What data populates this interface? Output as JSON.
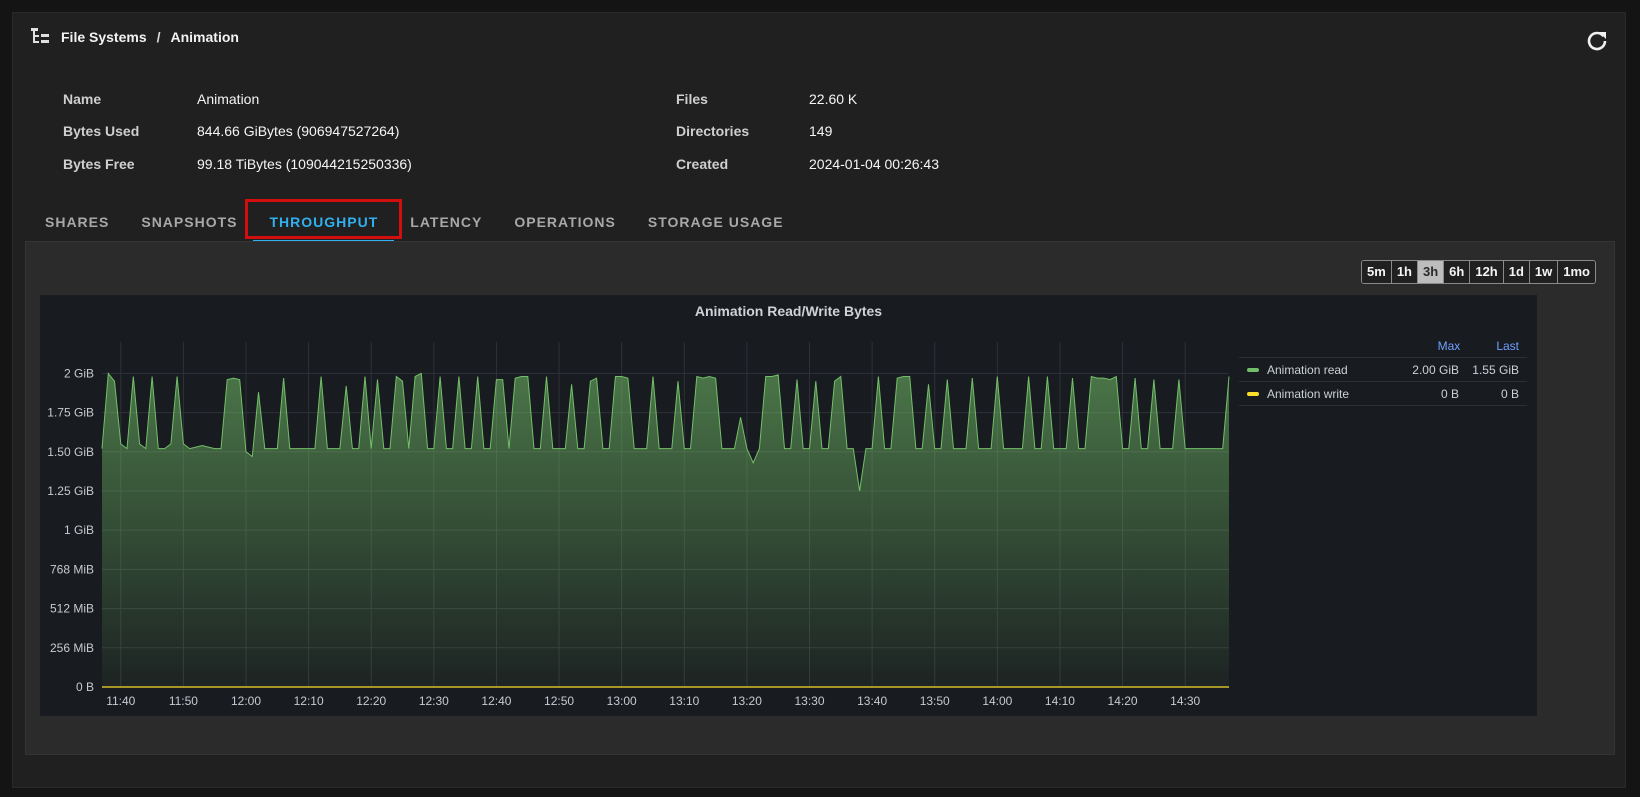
{
  "breadcrumb": {
    "root": "File Systems",
    "separator": "/",
    "current": "Animation"
  },
  "icons": {
    "tree": "tree-structure-icon",
    "refresh": "refresh-icon"
  },
  "details": {
    "name_label": "Name",
    "name_value": "Animation",
    "bytes_used_label": "Bytes Used",
    "bytes_used_value": "844.66 GiBytes (906947527264)",
    "bytes_free_label": "Bytes Free",
    "bytes_free_value": "99.18 TiBytes (109044215250336)",
    "files_label": "Files",
    "files_value": "22.60 K",
    "directories_label": "Directories",
    "directories_value": "149",
    "created_label": "Created",
    "created_value": "2024-01-04 00:26:43"
  },
  "tabs": [
    {
      "label": "SHARES"
    },
    {
      "label": "SNAPSHOTS"
    },
    {
      "label": "THROUGHPUT",
      "active": true
    },
    {
      "label": "LATENCY"
    },
    {
      "label": "OPERATIONS"
    },
    {
      "label": "STORAGE USAGE"
    }
  ],
  "time_ranges": [
    "5m",
    "1h",
    "3h",
    "6h",
    "12h",
    "1d",
    "1w",
    "1mo"
  ],
  "selected_range": "3h",
  "colors": {
    "accent": "#31b0ef",
    "read": "#73bf69",
    "write": "#fade2a",
    "highlight": "#d10f0f"
  },
  "legend": {
    "max_header": "Max",
    "last_header": "Last",
    "rows": [
      {
        "name": "Animation read",
        "max": "2.00 GiB",
        "last": "1.55 GiB"
      },
      {
        "name": "Animation write",
        "max": "0 B",
        "last": "0 B"
      }
    ]
  },
  "chart_data": {
    "type": "area",
    "title": "Animation Read/Write Bytes",
    "y_unit": "GiB",
    "ylim": [
      0,
      2.2
    ],
    "y_ticks": [
      {
        "value": 0,
        "label": "0 B"
      },
      {
        "value": 0.25,
        "label": "256 MiB"
      },
      {
        "value": 0.5,
        "label": "512 MiB"
      },
      {
        "value": 0.75,
        "label": "768 MiB"
      },
      {
        "value": 1,
        "label": "1 GiB"
      },
      {
        "value": 1.25,
        "label": "1.25 GiB"
      },
      {
        "value": 1.5,
        "label": "1.50 GiB"
      },
      {
        "value": 1.75,
        "label": "1.75 GiB"
      },
      {
        "value": 2,
        "label": "2 GiB"
      }
    ],
    "x_ticks": [
      "11:40",
      "11:50",
      "12:00",
      "12:10",
      "12:20",
      "12:30",
      "12:40",
      "12:50",
      "13:00",
      "13:10",
      "13:20",
      "13:30",
      "13:40",
      "13:50",
      "14:00",
      "14:10",
      "14:20",
      "14:30"
    ],
    "x_range_minutes": [
      37,
      217
    ],
    "grid": true,
    "legend_position": "right",
    "series": [
      {
        "name": "Animation read",
        "color": "#73bf69",
        "x_minutes": [
          37,
          38,
          39,
          40,
          41,
          42,
          43,
          44,
          45,
          46,
          47,
          48,
          49,
          50,
          51,
          52,
          53,
          54,
          55,
          56,
          57,
          58,
          59,
          60,
          61,
          62,
          63,
          64,
          65,
          66,
          67,
          68,
          69,
          70,
          71,
          72,
          73,
          74,
          75,
          76,
          77,
          78,
          79,
          80,
          81,
          82,
          83,
          84,
          85,
          86,
          87,
          88,
          89,
          90,
          91,
          92,
          93,
          94,
          95,
          96,
          97,
          98,
          99,
          100,
          101,
          102,
          103,
          104,
          105,
          106,
          107,
          108,
          109,
          110,
          111,
          112,
          113,
          114,
          115,
          116,
          117,
          118,
          119,
          120,
          121,
          122,
          123,
          124,
          125,
          126,
          127,
          128,
          129,
          130,
          131,
          132,
          133,
          134,
          135,
          136,
          137,
          138,
          139,
          140,
          141,
          142,
          143,
          144,
          145,
          146,
          147,
          148,
          149,
          150,
          151,
          152,
          153,
          154,
          155,
          156,
          157,
          158,
          159,
          160,
          161,
          162,
          163,
          164,
          165,
          166,
          167,
          168,
          169,
          170,
          171,
          172,
          173,
          174,
          175,
          176,
          177,
          178,
          179,
          180,
          181,
          182,
          183,
          184,
          185,
          186,
          187,
          188,
          189,
          190,
          191,
          192,
          193,
          194,
          195,
          196,
          197,
          198,
          199,
          200,
          201,
          202,
          203,
          204,
          205,
          206,
          207,
          208,
          209,
          210,
          211,
          212,
          213,
          214,
          215,
          216,
          217
        ],
        "values": [
          1.52,
          2.0,
          1.95,
          1.55,
          1.52,
          1.98,
          1.55,
          1.52,
          1.98,
          1.52,
          1.52,
          1.55,
          1.98,
          1.55,
          1.52,
          1.53,
          1.54,
          1.53,
          1.52,
          1.52,
          1.96,
          1.97,
          1.96,
          1.5,
          1.47,
          1.88,
          1.52,
          1.52,
          1.52,
          1.97,
          1.52,
          1.52,
          1.52,
          1.52,
          1.52,
          1.98,
          1.52,
          1.52,
          1.52,
          1.92,
          1.52,
          1.52,
          1.98,
          1.52,
          1.96,
          1.52,
          1.52,
          1.98,
          1.95,
          1.52,
          1.98,
          2.0,
          1.52,
          1.52,
          1.98,
          1.52,
          1.52,
          1.98,
          1.52,
          1.52,
          1.98,
          1.52,
          1.52,
          1.96,
          1.96,
          1.52,
          1.97,
          1.98,
          1.98,
          1.52,
          1.52,
          1.98,
          1.52,
          1.52,
          1.52,
          1.93,
          1.52,
          1.52,
          1.95,
          1.97,
          1.52,
          1.52,
          1.98,
          1.98,
          1.97,
          1.52,
          1.52,
          1.52,
          1.98,
          1.52,
          1.52,
          1.52,
          1.95,
          1.52,
          1.52,
          1.98,
          1.97,
          1.98,
          1.97,
          1.52,
          1.52,
          1.52,
          1.72,
          1.52,
          1.43,
          1.52,
          1.98,
          1.98,
          1.99,
          1.52,
          1.52,
          1.96,
          1.52,
          1.52,
          1.95,
          1.52,
          1.52,
          1.95,
          1.98,
          1.52,
          1.52,
          1.25,
          1.52,
          1.52,
          1.98,
          1.52,
          1.52,
          1.97,
          1.98,
          1.98,
          1.52,
          1.52,
          1.93,
          1.52,
          1.52,
          1.96,
          1.52,
          1.52,
          1.52,
          1.97,
          1.52,
          1.52,
          1.52,
          1.98,
          1.52,
          1.52,
          1.52,
          1.52,
          1.98,
          1.52,
          1.52,
          1.98,
          1.52,
          1.52,
          1.52,
          1.97,
          1.52,
          1.52,
          1.98,
          1.97,
          1.97,
          1.96,
          1.98,
          1.52,
          1.52,
          1.97,
          1.52,
          1.52,
          1.96,
          1.52,
          1.52,
          1.52,
          1.96,
          1.52,
          1.52,
          1.52,
          1.52,
          1.52,
          1.52,
          1.52,
          1.98,
          1.55,
          1.52,
          1.98,
          1.55
        ]
      },
      {
        "name": "Animation write",
        "color": "#fade2a",
        "x_minutes": [
          37,
          217
        ],
        "values": [
          0,
          0
        ]
      }
    ]
  }
}
